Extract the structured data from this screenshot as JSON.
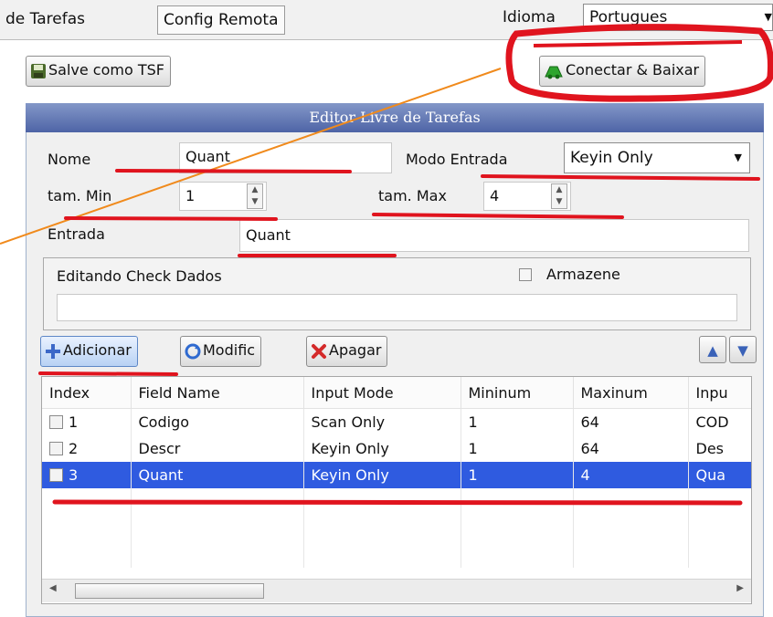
{
  "tabs": {
    "tarefas_label": "de Tarefas",
    "config_label": "Config Remota"
  },
  "idioma": {
    "label": "Idioma",
    "value": "Portugues"
  },
  "toolbar": {
    "save_tsf_label": "Salve como TSF",
    "connect_label": "Conectar & Baixar"
  },
  "editor": {
    "title": "Editor Livre de Tarefas",
    "nome_label": "Nome",
    "nome_value": "Quant",
    "modo_label": "Modo Entrada",
    "modo_value": "Keyin Only",
    "tam_min_label": "tam. Min",
    "tam_min_value": "1",
    "tam_max_label": "tam. Max",
    "tam_max_value": "4",
    "entrada_label": "Entrada",
    "entrada_value": "Quant",
    "check_label": "Editando Check Dados",
    "armazene_label": "Armazene",
    "check_value": ""
  },
  "actions": {
    "adicionar": "Adicionar",
    "modific": "Modific",
    "apagar": "Apagar"
  },
  "table": {
    "headers": [
      "Index",
      "Field Name",
      "Input Mode",
      "Mininum",
      "Maxinum",
      "Inpu"
    ],
    "rows": [
      [
        "1",
        "Codigo",
        "Scan Only",
        "1",
        "64",
        "COD"
      ],
      [
        "2",
        "Descr",
        "Keyin Only",
        "1",
        "64",
        "Des"
      ],
      [
        "3",
        "Quant",
        "Keyin Only",
        "1",
        "4",
        "Qua"
      ]
    ],
    "selected_row": 3
  },
  "colors": {
    "selection": "#2f5be0",
    "header_bar": "#5b70b0",
    "annotation_red": "#e0141e",
    "annotation_orange": "#f08a1c"
  },
  "icons": [
    "save-icon",
    "connect-icon",
    "add-icon",
    "refresh-icon",
    "delete-icon",
    "arrow-up-icon",
    "arrow-down-icon",
    "chevron-down-icon",
    "spinner-up-icon",
    "spinner-down-icon"
  ]
}
